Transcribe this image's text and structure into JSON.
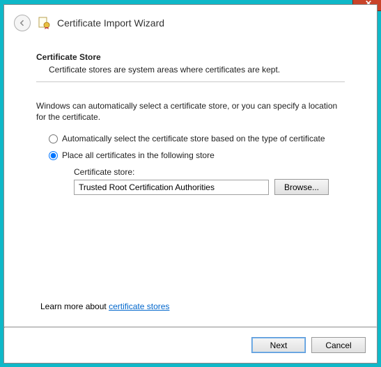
{
  "window": {
    "title": "Certificate Import Wizard",
    "close_symbol": "✕"
  },
  "section": {
    "title": "Certificate Store",
    "description": "Certificate stores are system areas where certificates are kept."
  },
  "intro": "Windows can automatically select a certificate store, or you can specify a location for the certificate.",
  "options": {
    "auto": "Automatically select the certificate store based on the type of certificate",
    "place": "Place all certificates in the following store"
  },
  "store": {
    "label": "Certificate store:",
    "value": "Trusted Root Certification Authorities",
    "browse": "Browse..."
  },
  "learn_more": {
    "prefix": "Learn more about ",
    "link_text": "certificate stores"
  },
  "buttons": {
    "next": "Next",
    "cancel": "Cancel"
  }
}
